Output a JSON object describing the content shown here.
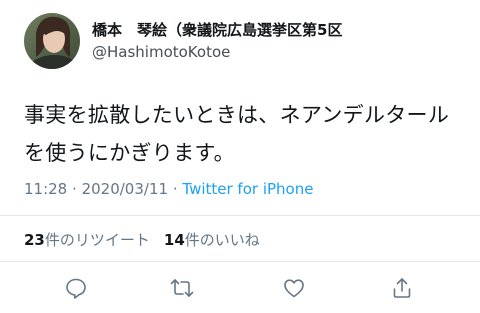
{
  "user": {
    "display_name": "橋本　琴絵（衆議院広島選挙区第5区",
    "handle": "@HashimotoKotoe"
  },
  "tweet": {
    "text": "事実を拡散したいときは、ネアンデルタールを使うにかぎります。",
    "time": "11:28",
    "separator": "·",
    "date": "2020/03/11",
    "source": "Twitter for iPhone"
  },
  "stats": {
    "retweet_count": "23",
    "retweet_label": "件のリツイート",
    "like_count": "14",
    "like_label": "件のいいね"
  },
  "actions": {
    "icons": [
      "reply-icon",
      "retweet-icon",
      "like-icon",
      "share-icon"
    ]
  },
  "colors": {
    "link": "#1da1f2",
    "meta": "#657786",
    "text": "#14171a",
    "divider": "#e1e8ed"
  }
}
